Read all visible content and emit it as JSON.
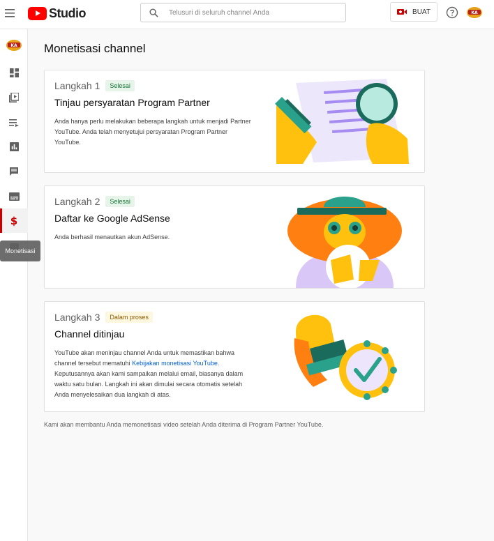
{
  "header": {
    "brand": "Studio",
    "search_placeholder": "Telusuri di seluruh channel Anda",
    "create_label": "BUAT"
  },
  "sidebar": {
    "tooltip": "Monetisasi",
    "items": [
      {
        "icon": "channel-avatar"
      },
      {
        "icon": "dashboard-icon"
      },
      {
        "icon": "video-library-icon"
      },
      {
        "icon": "playlist-icon"
      },
      {
        "icon": "analytics-icon"
      },
      {
        "icon": "comments-icon"
      },
      {
        "icon": "subtitles-icon"
      },
      {
        "icon": "monetization-icon",
        "active": true
      }
    ]
  },
  "main": {
    "title": "Monetisasi channel",
    "steps": [
      {
        "step": "Langkah 1",
        "status": "Selesai",
        "title": "Tinjau persyaratan Program Partner",
        "desc": "Anda hanya perlu melakukan beberapa langkah untuk menjadi Partner YouTube. Anda telah menyetujui persyaratan Program Partner YouTube."
      },
      {
        "step": "Langkah 2",
        "status": "Selesai",
        "title": "Daftar ke Google AdSense",
        "desc": "Anda berhasil menautkan akun AdSense."
      },
      {
        "step": "Langkah 3",
        "status": "Dalam proses",
        "title": "Channel ditinjau",
        "desc_before": "YouTube akan meninjau channel Anda untuk memastikan bahwa channel tersebut mematuhi ",
        "desc_link": "Kebijakan monetisasi YouTube",
        "desc_after": ". Keputusannya akan kami sampaikan melalui email, biasanya dalam waktu satu bulan. Langkah ini akan dimulai secara otomatis setelah Anda menyelesaikan dua langkah di atas."
      }
    ],
    "footer": "Kami akan membantu Anda memonetisasi video setelah Anda diterima di Program Partner YouTube."
  },
  "colors": {
    "brand_red": "#ff0000",
    "done_green": "#137333",
    "progress_amber": "#8a5a00",
    "link_blue": "#065fd4"
  }
}
